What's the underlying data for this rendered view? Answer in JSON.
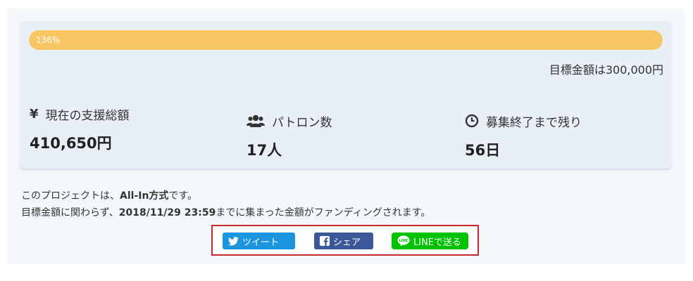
{
  "progress": {
    "label": "136%",
    "percent": 136,
    "color": "#f9c664"
  },
  "goal_text": "目標金額は300,000円",
  "stats": [
    {
      "icon": "yen-icon",
      "label": "現在の支援総額",
      "value": "410,650円"
    },
    {
      "icon": "users-icon",
      "label": "パトロン数",
      "value": "17人"
    },
    {
      "icon": "clock-icon",
      "label": "募集終了まで残り",
      "value": "56日"
    }
  ],
  "yen_symbol": "¥",
  "note": {
    "line1_prefix": "このプロジェクトは、",
    "line1_bold": "All-In方式",
    "line1_suffix": "です。",
    "line2_prefix": "目標金額に関わらず、",
    "line2_bold": "2018/11/29 23:59",
    "line2_suffix": "までに集まった金額がファンディングされます。"
  },
  "share": {
    "tweet_label": "ツイート",
    "facebook_label": "シェア",
    "line_label": "LINEで送る",
    "line_icon_text": "LINE",
    "colors": {
      "twitter": "#1b95e0",
      "facebook": "#3b5998",
      "line": "#00c300",
      "highlight": "#c62828"
    }
  }
}
